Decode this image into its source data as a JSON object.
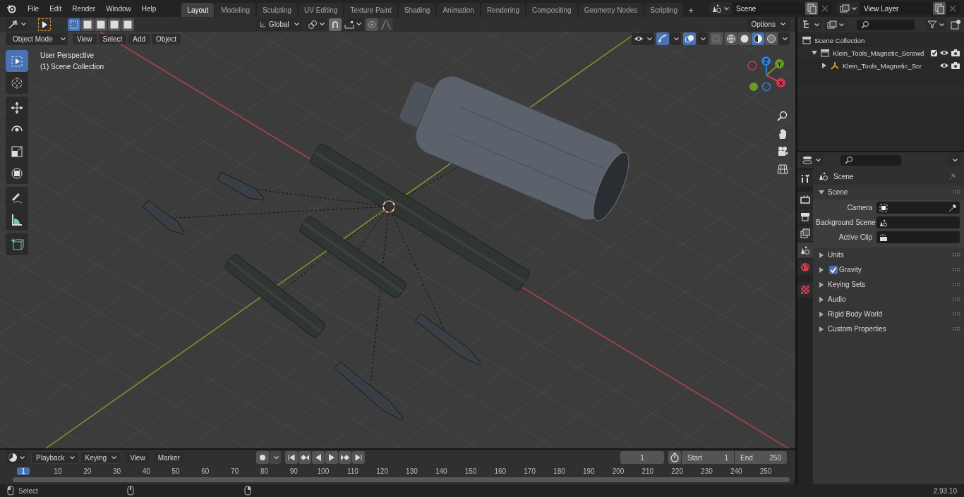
{
  "menu_bar": {
    "menus": [
      "File",
      "Edit",
      "Render",
      "Window",
      "Help"
    ]
  },
  "workspace_tabs": [
    {
      "label": "Layout",
      "selected": true
    },
    {
      "label": "Modeling",
      "selected": false
    },
    {
      "label": "Sculpting",
      "selected": false
    },
    {
      "label": "UV Editing",
      "selected": false
    },
    {
      "label": "Texture Paint",
      "selected": false
    },
    {
      "label": "Shading",
      "selected": false
    },
    {
      "label": "Animation",
      "selected": false
    },
    {
      "label": "Rendering",
      "selected": false
    },
    {
      "label": "Compositing",
      "selected": false
    },
    {
      "label": "Geometry Nodes",
      "selected": false
    },
    {
      "label": "Scripting",
      "selected": false
    }
  ],
  "add_workspace": "+",
  "scene_selector": {
    "value": "Scene"
  },
  "view_layer_selector": {
    "value": "View Layer"
  },
  "viewport": {
    "select_modes": [
      {
        "selected": true
      },
      {
        "selected": false
      },
      {
        "selected": false
      },
      {
        "selected": false
      },
      {
        "selected": false
      }
    ],
    "orientation": "Global",
    "options": "Options",
    "mode": "Object Mode",
    "menus": [
      "View",
      "Select",
      "Add",
      "Object"
    ],
    "shading_modes": [
      {
        "kind": "wireframe",
        "selected": false
      },
      {
        "kind": "solid",
        "selected": false
      },
      {
        "kind": "material",
        "selected": true
      },
      {
        "kind": "rendered",
        "selected": false
      }
    ],
    "overlay_text": [
      "User Perspective",
      "(1) Scene Collection"
    ],
    "tool_groups": [
      {
        "tools": [
          {
            "kind": "select",
            "selected": true
          },
          {
            "kind": "cursor",
            "selected": false
          }
        ]
      },
      {
        "tools": [
          {
            "kind": "move",
            "selected": false
          },
          {
            "kind": "rotate",
            "selected": false
          },
          {
            "kind": "scale",
            "selected": false
          },
          {
            "kind": "transform",
            "selected": false
          }
        ]
      },
      {
        "tools": [
          {
            "kind": "annotate",
            "selected": false
          },
          {
            "kind": "measure",
            "selected": false
          }
        ]
      },
      {
        "tools": [
          {
            "kind": "add_cube",
            "selected": false
          }
        ]
      }
    ],
    "gizmo_axes": [
      {
        "label": "Z",
        "color": "#2f7fd6"
      },
      {
        "label": "Y",
        "color": "#6a9b22"
      },
      {
        "label": "X",
        "color": "#d43a4d"
      }
    ]
  },
  "outliner": {
    "items": [
      {
        "label": "Scene Collection",
        "kind": "scene",
        "children": [
          {
            "label": "Klein_Tools_Magnetic_Screwd",
            "kind": "collection",
            "expanded": true,
            "checked": true,
            "children": [
              {
                "label": "Klein_Tools_Magnetic_Scr",
                "kind": "object",
                "expanded": false
              }
            ]
          }
        ]
      }
    ]
  },
  "properties": {
    "tabs": [
      {
        "kind": "tool",
        "selected": false
      },
      {
        "kind": "render",
        "selected": false
      },
      {
        "kind": "output",
        "selected": false
      },
      {
        "kind": "view_layer",
        "selected": false
      },
      {
        "kind": "scene",
        "selected": true
      },
      {
        "kind": "world",
        "selected": false
      },
      {
        "kind": "texture",
        "selected": false
      }
    ],
    "context": "Scene",
    "panels": [
      {
        "title": "Scene",
        "kind": "plain",
        "expanded": true,
        "fields": [
          {
            "label": "Camera",
            "kind": "camera"
          },
          {
            "label": "Background Scene",
            "kind": "scene"
          },
          {
            "label": "Active Clip",
            "kind": "clip"
          }
        ]
      },
      {
        "title": "Units",
        "kind": "plain",
        "expanded": false
      },
      {
        "title": "Gravity",
        "kind": "toggle",
        "checked": true,
        "expanded": false
      },
      {
        "title": "Keying Sets",
        "kind": "plain",
        "expanded": false
      },
      {
        "title": "Audio",
        "kind": "plain",
        "expanded": false
      },
      {
        "title": "Rigid Body World",
        "kind": "plain",
        "expanded": false
      },
      {
        "title": "Custom Properties",
        "kind": "plain",
        "expanded": false
      }
    ]
  },
  "timeline": {
    "menus": [
      {
        "label": "Playback",
        "kind": "dropdown"
      },
      {
        "label": "Keying",
        "kind": "dropdown"
      },
      {
        "label": "View",
        "kind": "menu"
      },
      {
        "label": "Marker",
        "kind": "menu"
      }
    ],
    "current_frame": "1",
    "start_label": "Start",
    "start": "1",
    "end_label": "End",
    "end": "250",
    "playhead": "1",
    "ruler": [
      "10",
      "20",
      "30",
      "40",
      "50",
      "60",
      "70",
      "80",
      "90",
      "100",
      "110",
      "120",
      "130",
      "140",
      "150",
      "160",
      "170",
      "180",
      "190",
      "200",
      "210",
      "220",
      "230",
      "240",
      "250"
    ]
  },
  "status_bar": {
    "hint": "Select",
    "version": "2.93.10"
  }
}
